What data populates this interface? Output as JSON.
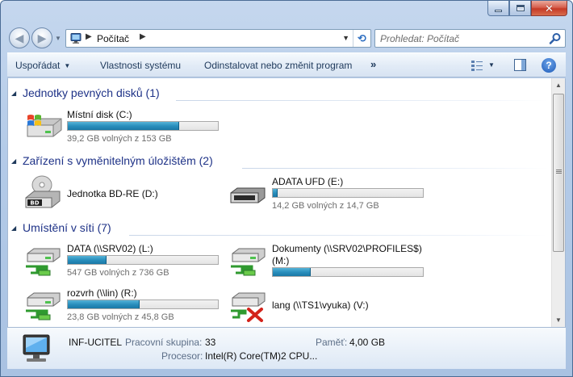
{
  "window": {
    "minimize_glyph": "–",
    "close_glyph": "✕"
  },
  "address_bar": {
    "separator": "▶",
    "breadcrumb": "Počítač",
    "dropdown": "▼",
    "refresh_glyph": "⟲"
  },
  "search": {
    "placeholder": "Prohledat: Počítač"
  },
  "nav": {
    "back_glyph": "◀",
    "forward_glyph": "▶",
    "history_glyph": "▼"
  },
  "toolbar": {
    "organize": "Uspořádat",
    "system_properties": "Vlastnosti systému",
    "uninstall": "Odinstalovat nebo změnit program",
    "more": "»",
    "dropdown": "▼",
    "help": "?"
  },
  "groups": [
    {
      "title": "Jednotky pevných disků (1)",
      "collapse_glyph": "◢"
    },
    {
      "title": "Zařízení s vyměnitelným úložištěm (2)",
      "collapse_glyph": "◢"
    },
    {
      "title": "Umístění v síti (7)",
      "collapse_glyph": "◢"
    }
  ],
  "drives": [
    {
      "name": "Místní disk (C:)",
      "free": "39,2 GB volných z 153 GB",
      "used_fraction": 0.744,
      "icon": "local-disk-windows-icon"
    },
    {
      "name": "Jednotka BD-RE (D:)",
      "icon": "bd-re-drive-icon",
      "badge": "BD"
    },
    {
      "name": "ADATA UFD (E:)",
      "free": "14,2 GB volných z 14,7 GB",
      "used_fraction": 0.034,
      "icon": "usb-drive-icon"
    },
    {
      "name": "DATA (\\\\SRV02) (L:)",
      "free": "547 GB volných z 736 GB",
      "used_fraction": 0.257,
      "icon": "network-drive-icon"
    },
    {
      "name": "Dokumenty (\\\\SRV02\\PROFILES$)",
      "name_line2": "(M:)",
      "used_fraction": 0.25,
      "icon": "network-drive-icon"
    },
    {
      "name": "rozvrh (\\\\lin) (R:)",
      "free": "23,8 GB volných z 45,8 GB",
      "used_fraction": 0.48,
      "icon": "network-drive-icon"
    },
    {
      "name": "lang (\\\\TS1\\vyuka) (V:)",
      "icon": "disconnected-network-drive-icon"
    }
  ],
  "details": {
    "computer_name": "INF-UCITEL",
    "workgroup_label": "Pracovní skupina:",
    "workgroup_value": "33",
    "memory_label": "Paměť:",
    "memory_value": "4,00 GB",
    "cpu_label": "Procesor:",
    "cpu_value": "Intel(R) Core(TM)2 CPU..."
  },
  "colors": {
    "accent": "#1e3287",
    "bar_fill": "#2a8fbd"
  }
}
